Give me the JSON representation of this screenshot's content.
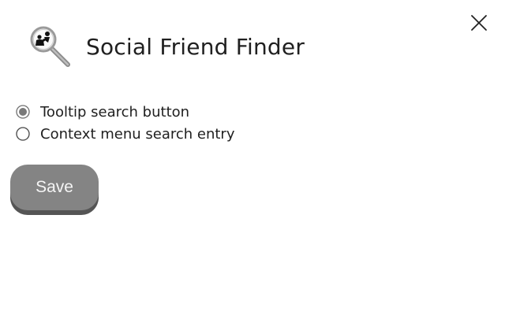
{
  "header": {
    "title": "Social Friend Finder",
    "logo_icon": "magnifier-with-friends-icon"
  },
  "close": {
    "icon": "close-icon"
  },
  "options": [
    {
      "label": "Tooltip search button",
      "selected": true
    },
    {
      "label": "Context menu search entry",
      "selected": false
    }
  ],
  "save": {
    "label": "Save"
  },
  "colors": {
    "button_bg": "#848484",
    "button_shadow": "#555555",
    "button_text": "#f5f5f5",
    "radio_checked": "#7a7a7a",
    "text": "#202020"
  }
}
